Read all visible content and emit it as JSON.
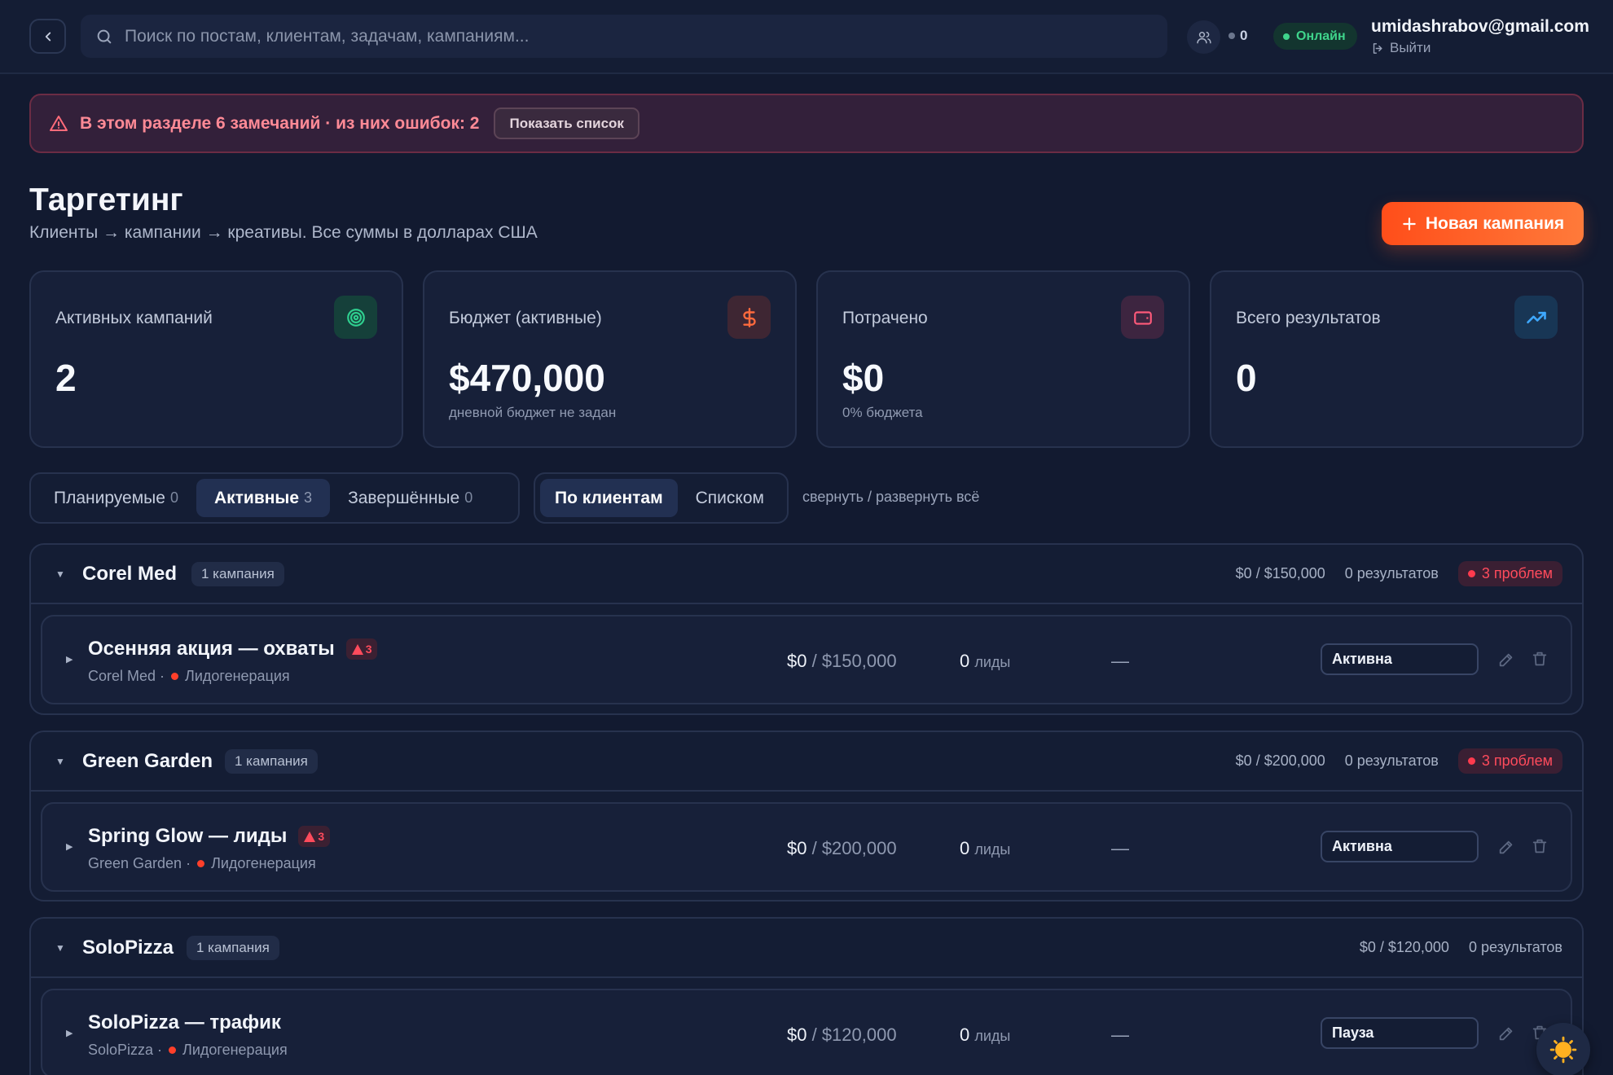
{
  "topbar": {
    "search_placeholder": "Поиск по постам, клиентам, задачам, кампаниям...",
    "online_users_count": "0",
    "status_label": "Онлайн",
    "user_email": "umidashrabov@gmail.com",
    "logout_label": "Выйти"
  },
  "alert": {
    "text": "В этом разделе 6 замечаний · из них ошибок: 2",
    "button_label": "Показать список"
  },
  "header": {
    "title": "Таргетинг",
    "subtitle": "Клиенты → кампании → креативы. Все суммы в долларах США",
    "new_campaign_label": "Новая кампания"
  },
  "stats": [
    {
      "label": "Активных кампаний",
      "value": "2",
      "sub": "",
      "icon": "target-icon",
      "color": "#2fcf8f"
    },
    {
      "label": "Бюджет (активные)",
      "value": "$470,000",
      "sub": "дневной бюджет не задан",
      "icon": "dollar-icon",
      "color": "#ff6a3d"
    },
    {
      "label": "Потрачено",
      "value": "$0",
      "sub": "0% бюджета",
      "icon": "wallet-icon",
      "color": "#ff5a7a"
    },
    {
      "label": "Всего результатов",
      "value": "0",
      "sub": "",
      "icon": "trending-up-icon",
      "color": "#3ea8ff"
    }
  ],
  "status_tabs": [
    {
      "label": "Планируемые",
      "count": "0"
    },
    {
      "label": "Активные",
      "count": "3"
    },
    {
      "label": "Завершённые",
      "count": "0"
    }
  ],
  "view_tabs": [
    {
      "label": "По клиентам"
    },
    {
      "label": "Списком"
    }
  ],
  "collapse_label": "свернуть / развернуть всё",
  "groups": [
    {
      "name": "Corel Med",
      "count_label": "1 кампания",
      "budget": "$0 / $150,000",
      "results": "0 результатов",
      "problems": "3 проблем",
      "campaign": {
        "title": "Осенняя акция — охваты",
        "warnings": "3",
        "client": "Corel Med ·",
        "objective": "Лидогенерация",
        "spent": "$0",
        "budget": " / $150,000",
        "results": "0",
        "results_unit": "лиды",
        "extra": "—",
        "status": "Активна"
      }
    },
    {
      "name": "Green Garden",
      "count_label": "1 кампания",
      "budget": "$0 / $200,000",
      "results": "0 результатов",
      "problems": "3 проблем",
      "campaign": {
        "title": "Spring Glow — лиды",
        "warnings": "3",
        "client": "Green Garden ·",
        "objective": "Лидогенерация",
        "spent": "$0",
        "budget": " / $200,000",
        "results": "0",
        "results_unit": "лиды",
        "extra": "—",
        "status": "Активна"
      }
    },
    {
      "name": "SoloPizza",
      "count_label": "1 кампания",
      "budget": "$0 / $120,000",
      "results": "0 результатов",
      "campaign": {
        "title": "SoloPizza — трафик",
        "client": "SoloPizza ·",
        "objective": "Лидогенерация",
        "spent": "$0",
        "budget": " / $120,000",
        "results": "0",
        "results_unit": "лиды",
        "extra": "—",
        "status": "Пауза"
      }
    }
  ]
}
